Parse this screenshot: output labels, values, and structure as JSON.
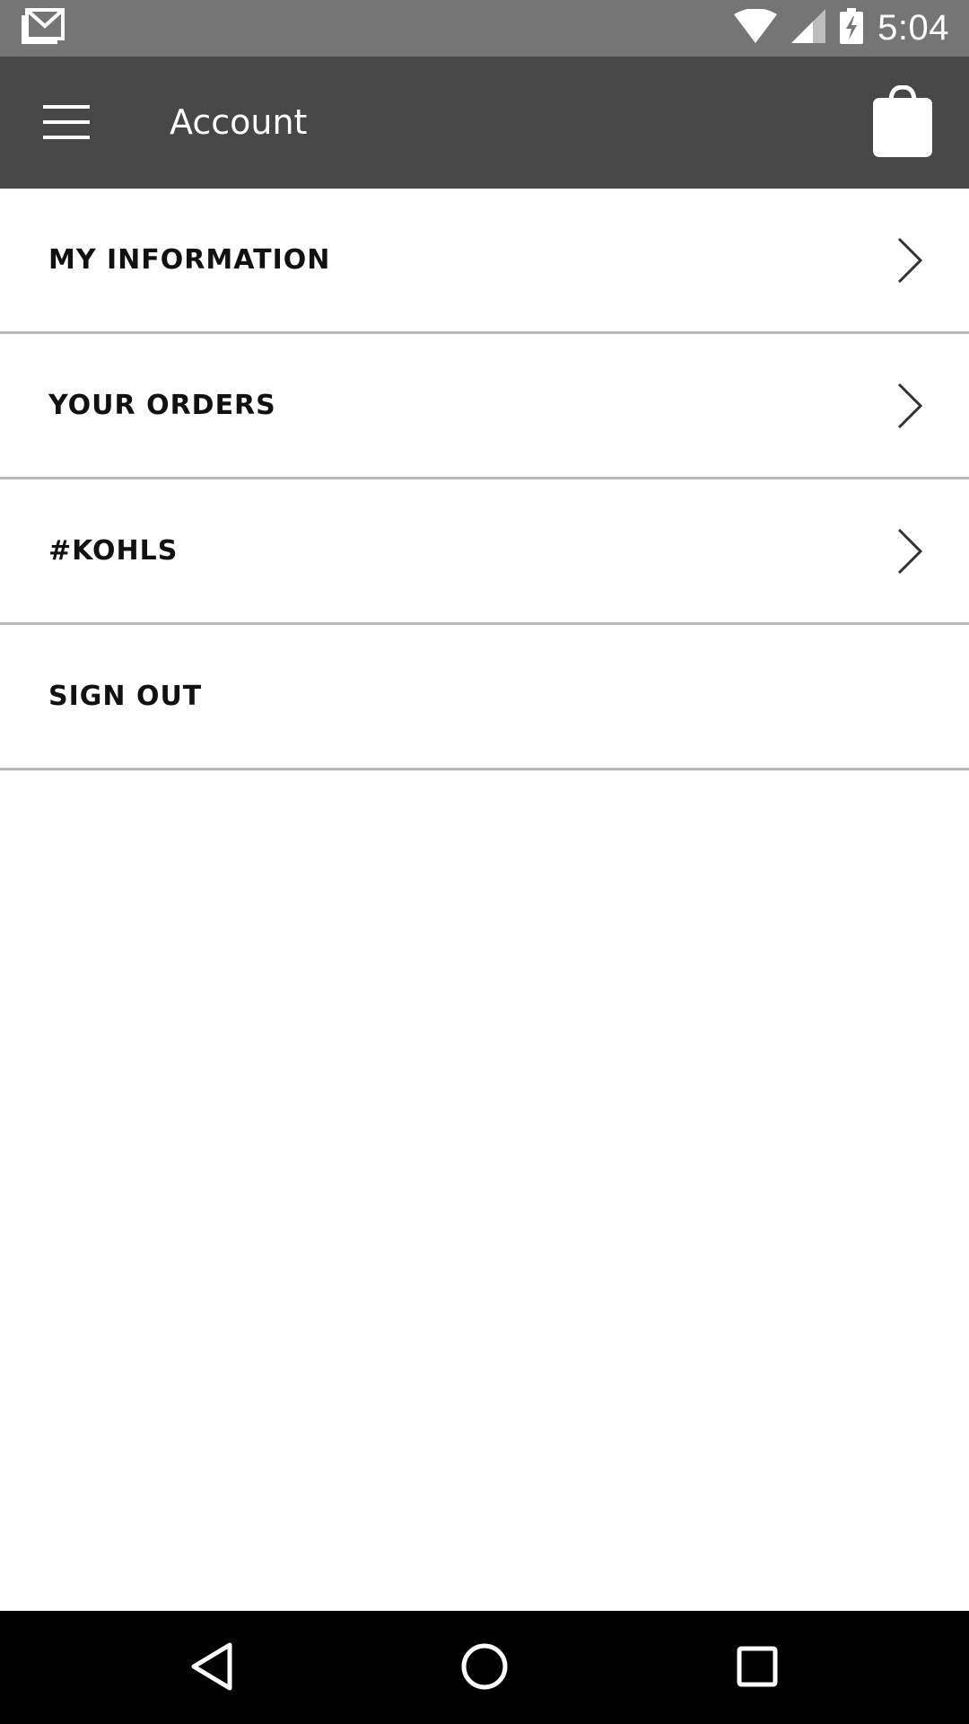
{
  "status_bar": {
    "time": "5:04",
    "icons": [
      "gmail-icon",
      "wifi-icon",
      "signal-icon",
      "battery-charging-icon"
    ]
  },
  "app_bar": {
    "title": "Account",
    "menu_icon": "hamburger-menu-icon",
    "bag_icon": "shopping-bag-icon"
  },
  "account_menu": {
    "items": [
      {
        "label": "MY INFORMATION",
        "icon": "chevron-right-icon"
      },
      {
        "label": "YOUR ORDERS",
        "icon": "chevron-right-icon"
      },
      {
        "label": "#KOHLS",
        "icon": "chevron-right-icon"
      },
      {
        "label": "SIGN OUT"
      }
    ]
  },
  "nav_bar": {
    "icons": [
      "back-icon",
      "home-icon",
      "recents-icon"
    ]
  },
  "colors": {
    "status_bar": "#757575",
    "app_bar": "#474747",
    "divider": "#b8b8b8",
    "nav_bar": "#000000"
  }
}
